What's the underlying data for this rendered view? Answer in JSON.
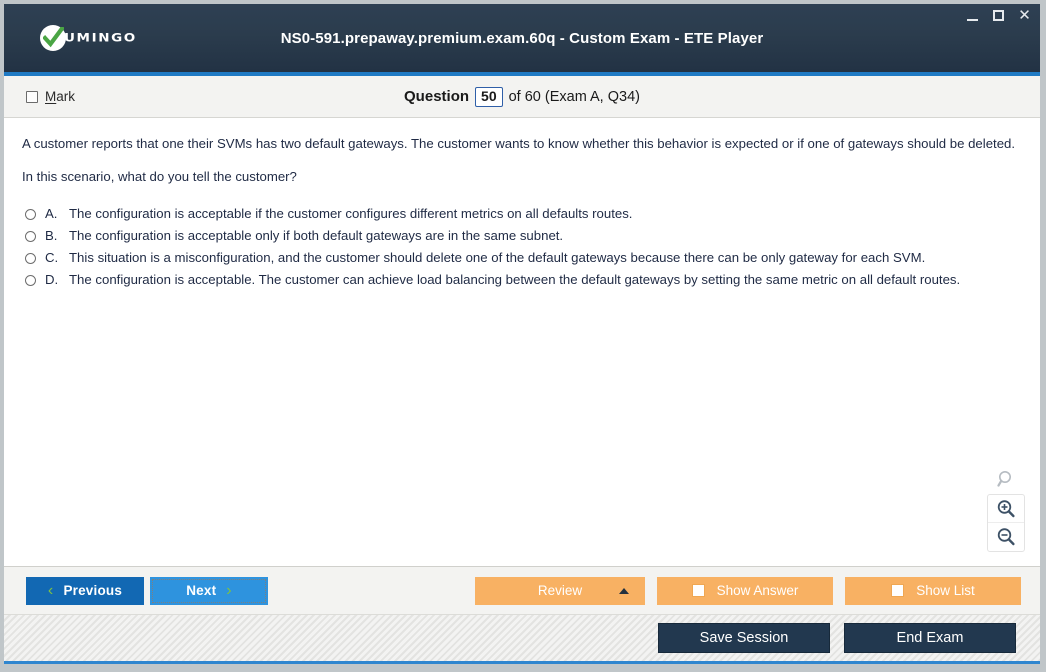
{
  "window": {
    "title": "NS0-591.prepaway.premium.exam.60q - Custom Exam - ETE Player",
    "logo_text": "UMINGO",
    "controls": {
      "minimize": "minimize-icon",
      "maximize": "maximize-icon",
      "close": "✕"
    }
  },
  "header": {
    "mark_label": "Mark",
    "mark_accelerator": "M",
    "question_word": "Question",
    "question_number": "50",
    "question_rest": "of 60 (Exam A, Q34)"
  },
  "question": {
    "paragraphs": [
      "A customer reports that one their SVMs has two default gateways. The customer wants to know whether this behavior is expected or if one of gateways should be deleted.",
      "In this scenario, what do you tell the customer?"
    ],
    "options": [
      {
        "letter": "A.",
        "text": "The configuration is acceptable if the customer configures different metrics on all defaults routes.",
        "selected": false
      },
      {
        "letter": "B.",
        "text": "The configuration is acceptable only if both default gateways are in the same subnet.",
        "selected": false
      },
      {
        "letter": "C.",
        "text": "This situation is a misconfiguration, and the customer should delete one of the default gateways because there can be only gateway for each SVM.",
        "selected": false
      },
      {
        "letter": "D.",
        "text": "The configuration is acceptable. The customer can achieve load balancing between the default gateways by setting the same metric on all default routes.",
        "selected": false
      }
    ]
  },
  "zoom_tools": {
    "search": "magnifier-icon",
    "zoom_in": "zoom-in-icon",
    "zoom_out": "zoom-out-icon"
  },
  "toolbar": {
    "previous_label": "Previous",
    "next_label": "Next",
    "previous_chevron": "‹",
    "next_chevron": "›",
    "review_label": "Review",
    "show_answer_label": "Show Answer",
    "show_list_label": "Show List"
  },
  "status_bar": {
    "save_session_label": "Save Session",
    "end_exam_label": "End Exam"
  },
  "colors": {
    "title_bar": "#2b3c4d",
    "accent_blue": "#1f7ac4",
    "previous_blue": "#1268b3",
    "next_blue": "#2e93de",
    "orange": "#f8b163",
    "dark_navy": "#22384f",
    "chevron_green": "#7fc241"
  }
}
